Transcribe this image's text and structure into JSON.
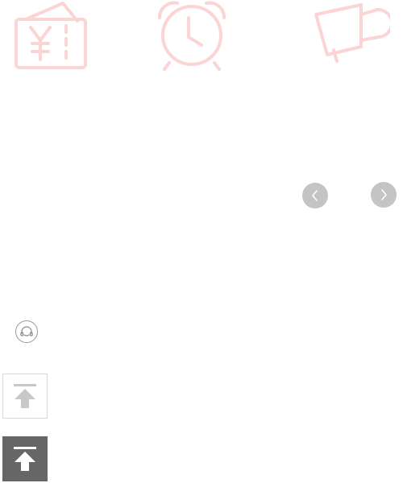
{
  "colors": {
    "icon_pink": "#fbd4d4",
    "carousel_button": "#c4c4c4",
    "back_top_light_arrow": "#c8c8c8",
    "back_top_dark_bg": "#666666",
    "back_top_dark_arrow": "#ffffff",
    "border_gray": "#d9d9d9"
  },
  "icons": {
    "top_row": [
      "wallet-yuan-icon",
      "alarm-clock-icon",
      "megaphone-icon"
    ],
    "carousel": [
      "chevron-left-icon",
      "chevron-right-icon"
    ],
    "service": "customer-service-icon",
    "back_to_top": [
      "back-to-top-icon",
      "back-to-top-icon"
    ]
  }
}
